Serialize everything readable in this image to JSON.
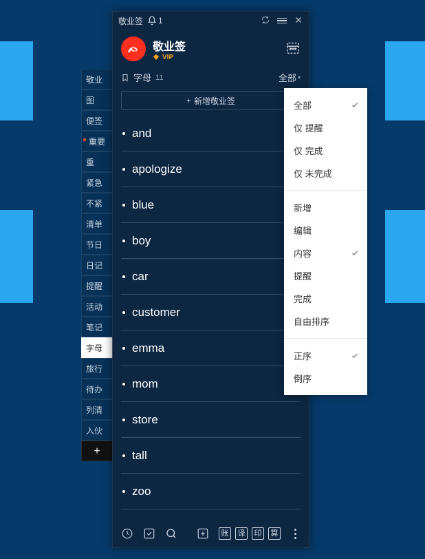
{
  "titlebar": {
    "app_name": "敬业签",
    "notif_count": "1"
  },
  "brand": {
    "name": "敬业签",
    "vip": "VIP"
  },
  "list": {
    "name": "字母",
    "count": "11",
    "filter_label": "全部",
    "add_label": "新增敬业签"
  },
  "sidebar": {
    "items": [
      "敬业",
      "图",
      "便签",
      "重要",
      "重",
      "紧急",
      "不紧",
      "清单",
      "节日",
      "日记",
      "提醒",
      "活动",
      "笔记",
      "字母",
      "旅行",
      "待办",
      "列清",
      "入伙"
    ],
    "active_index": 13,
    "highlight_index": 3
  },
  "notes": [
    "and",
    "apologize",
    "blue",
    "boy",
    "car",
    "customer",
    "emma",
    "mom",
    "store",
    "tall",
    "zoo"
  ],
  "dropdown": {
    "sections": [
      {
        "items": [
          "全部",
          "仅 提醒",
          "仅 完成",
          "仅 未完成"
        ],
        "selected": 0
      },
      {
        "items": [
          "新增",
          "编辑",
          "内容",
          "提醒",
          "完成",
          "自由排序"
        ],
        "selected": 2
      },
      {
        "items": [
          "正序",
          "倒序"
        ],
        "selected": 0
      }
    ]
  },
  "bottombar": {
    "sq_labels": [
      "账",
      "译",
      "印",
      "算"
    ]
  }
}
